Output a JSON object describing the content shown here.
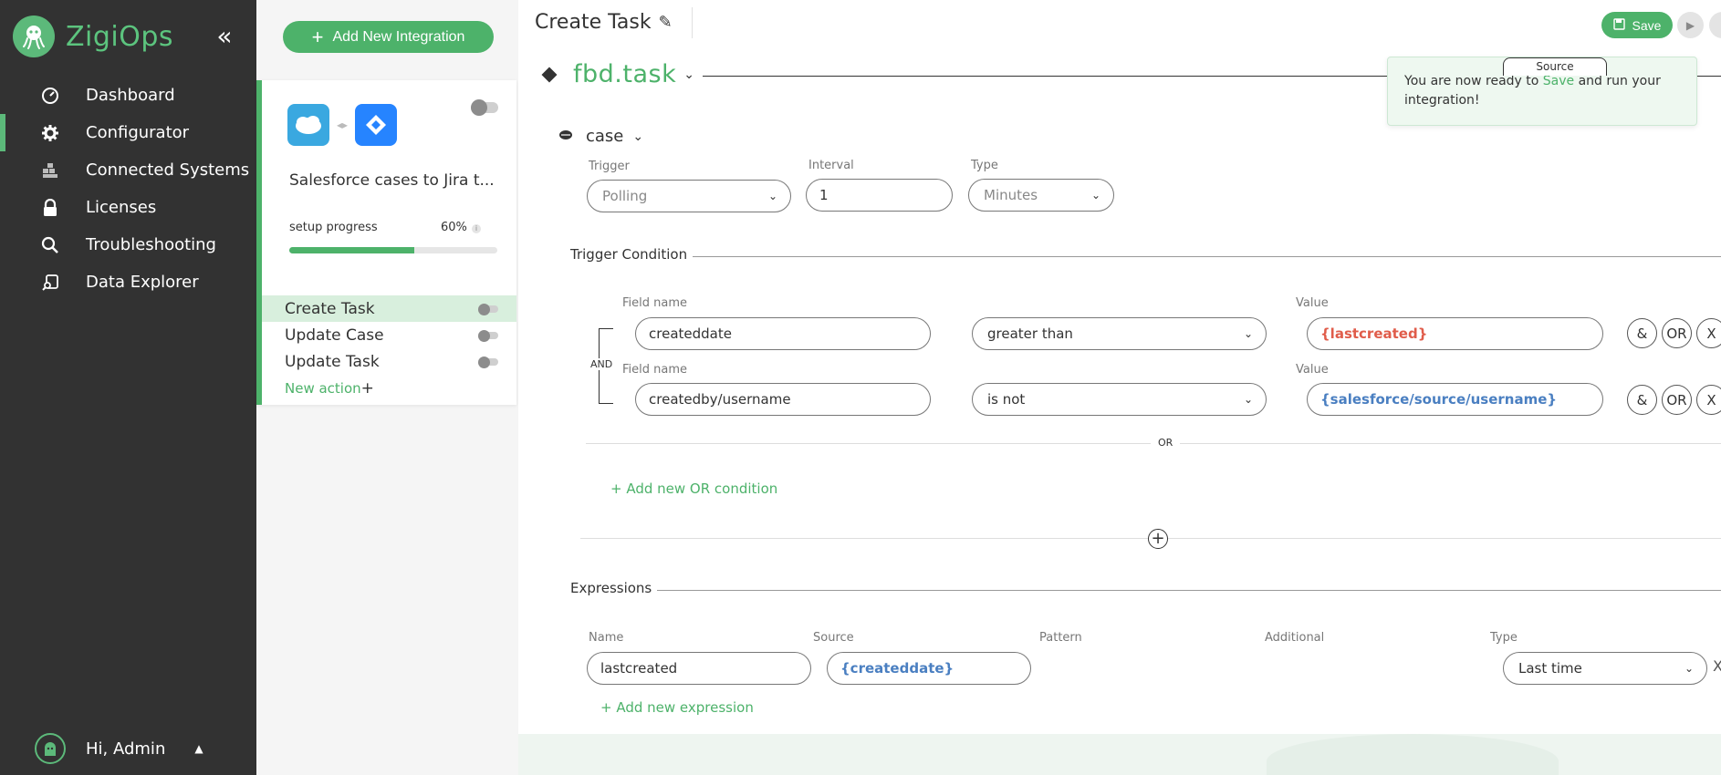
{
  "brand": {
    "name": "ZigiOps",
    "accent": "#4db26a"
  },
  "sidebar": {
    "items": [
      {
        "label": "Dashboard",
        "icon": "gauge-icon",
        "active": false
      },
      {
        "label": "Configurator",
        "icon": "gear-icon",
        "active": true
      },
      {
        "label": "Connected Systems",
        "icon": "boxes-icon",
        "active": false
      },
      {
        "label": "Licenses",
        "icon": "lock-icon",
        "active": false
      },
      {
        "label": "Troubleshooting",
        "icon": "search-icon",
        "active": false
      },
      {
        "label": "Data Explorer",
        "icon": "data-explorer-icon",
        "active": false
      }
    ],
    "user": {
      "greeting": "Hi, Admin"
    }
  },
  "integration": {
    "add_button": "Add New Integration",
    "title": "Salesforce cases to Jira t...",
    "progress_label": "setup progress",
    "progress_pct": "60%",
    "progress_value": 0.6,
    "actions": [
      {
        "label": "Create Task",
        "active": true
      },
      {
        "label": "Update Case",
        "active": false
      },
      {
        "label": "Update Task",
        "active": false
      }
    ],
    "new_action": "New action"
  },
  "main": {
    "title": "Create Task",
    "save_label": "Save",
    "task_name": "fbd.task",
    "source_tab": "Source",
    "tooltip": {
      "before": "You are now ready to ",
      "highlight": "Save",
      "after": " and run your integration!"
    },
    "case_label": "case",
    "trigger": {
      "trigger_label": "Trigger",
      "trigger_value": "Polling",
      "interval_label": "Interval",
      "interval_value": "1",
      "type_label": "Type",
      "type_value": "Minutes"
    },
    "trigger_condition": {
      "title": "Trigger Condition",
      "and_label": "AND",
      "rows": [
        {
          "field_label": "Field name",
          "field": "createddate",
          "operator": "greater than",
          "value_label": "Value",
          "value": "{lastcreated}"
        },
        {
          "field_label": "Field name",
          "field": "createdby/username",
          "operator": "is not",
          "value_label": "Value",
          "value": "{salesforce/source/username}"
        }
      ],
      "btn_and": "&",
      "btn_or": "OR",
      "btn_x": "X",
      "or_label": "OR",
      "add_or": "+ Add new OR condition"
    },
    "expressions": {
      "title": "Expressions",
      "name_label": "Name",
      "source_label": "Source",
      "pattern_label": "Pattern",
      "additional_label": "Additional",
      "type_label": "Type",
      "name_value": "lastcreated",
      "source_value": "{createddate}",
      "type_value": "Last time",
      "close": "X",
      "add_expression": "+ Add new expression"
    }
  }
}
